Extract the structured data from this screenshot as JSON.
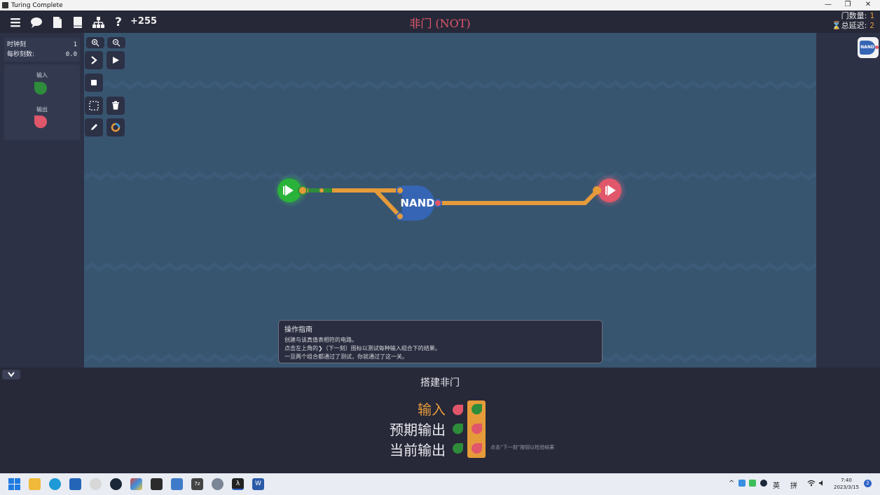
{
  "window": {
    "title": "Turing Complete",
    "controls": [
      "—",
      "❐",
      "✕"
    ]
  },
  "toolbar": {
    "score": "+255",
    "level_title": "非门 (NOT)",
    "gate_count_label": "门数量:",
    "gate_count": "1",
    "delay_label": "⌛总延迟:",
    "delay": "2",
    "icons": [
      "menu-icon",
      "chat-icon",
      "document-icon",
      "book-icon",
      "hierarchy-icon",
      "help-icon"
    ]
  },
  "left_panel": {
    "clock_label": "时钟刻",
    "clock_value": "1",
    "tps_label": "每秒刻数:",
    "tps_value": "0.0",
    "input_label": "输入",
    "output_label": "输出"
  },
  "circuit": {
    "gate_label": "NAND"
  },
  "guide": {
    "title": "操作指南",
    "lines": [
      "创建与该真值表相符的电路。",
      "点击左上角的❯（下一刻）图标以测试每种输入组合下的结果。",
      "一旦两个组合都通过了测试，你就通过了这一关。"
    ]
  },
  "bottom": {
    "task_title": "搭建非门",
    "row_input": "输入",
    "row_expected": "预期输出",
    "row_current": "当前输出",
    "hint": "点击“下一刻”按钮以检验结果",
    "truth_table": {
      "input": [
        "off",
        "on"
      ],
      "expected": [
        "on",
        "off"
      ],
      "current": [
        "on",
        "off"
      ]
    }
  },
  "taskbar": {
    "ime_lang": "英",
    "ime_mode": "拼",
    "time": "7:40",
    "date": "2023/3/15",
    "notifications": "2"
  },
  "colors": {
    "accent_orange": "#e59b3a",
    "on_green": "#2e8c3a",
    "off_red": "#e0566a",
    "canvas": "#385570",
    "gate_blue": "#3565b4"
  }
}
